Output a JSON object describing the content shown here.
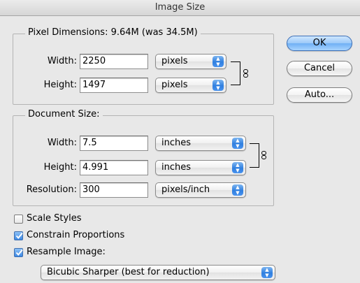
{
  "window": {
    "title": "Image Size"
  },
  "pixel_dimensions": {
    "legend": "Pixel Dimensions:  9.64M (was 34.5M)",
    "width_label": "Width:",
    "width_value": "2250",
    "width_unit": "pixels",
    "height_label": "Height:",
    "height_value": "1497",
    "height_unit": "pixels"
  },
  "buttons": {
    "ok": "OK",
    "cancel": "Cancel",
    "auto": "Auto..."
  },
  "document_size": {
    "legend": "Document Size:",
    "width_label": "Width:",
    "width_value": "7.5",
    "width_unit": "inches",
    "height_label": "Height:",
    "height_value": "4.991",
    "height_unit": "inches",
    "resolution_label": "Resolution:",
    "resolution_value": "300",
    "resolution_unit": "pixels/inch"
  },
  "options": {
    "scale_styles": {
      "label": "Scale Styles",
      "checked": false
    },
    "constrain_proportions": {
      "label": "Constrain Proportions",
      "checked": true
    },
    "resample_image": {
      "label": "Resample Image:",
      "checked": true
    },
    "resample_method": "Bicubic Sharper (best for reduction)"
  },
  "colors": {
    "accent": "#3b88e4",
    "default_button": "#9bc9f8"
  },
  "icons": {
    "link": "chain-link-icon",
    "popup": "up-down-arrows-icon",
    "check": "checkmark-icon"
  }
}
